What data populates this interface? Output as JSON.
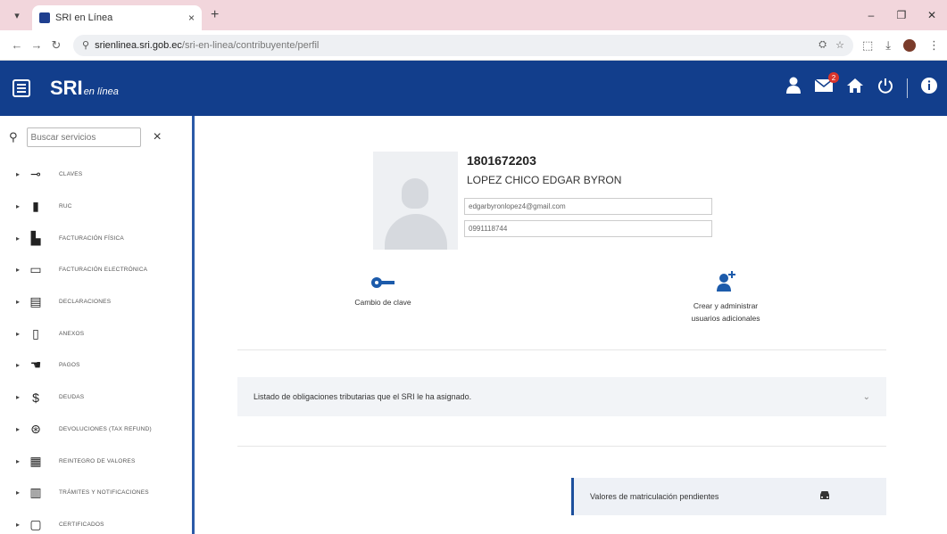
{
  "browser": {
    "tab_title": "SRI en Línea",
    "tab_close": "×",
    "new_tab": "+",
    "url_host": "srienlinea.sri.gob.ec",
    "url_path": "/sri-en-linea/contribuyente/perfil",
    "win_min": "–",
    "win_max": "❐",
    "win_close": "✕"
  },
  "header": {
    "logo": "SRI",
    "logo_suffix": "en línea",
    "notification_count": "2"
  },
  "sidebar": {
    "search_placeholder": "Buscar servicios",
    "close": "×",
    "items": [
      {
        "label": "CLAVES",
        "icon": "key-icon"
      },
      {
        "label": "RUC",
        "icon": "building-icon"
      },
      {
        "label": "FACTURACIÓN FÍSICA",
        "icon": "printer-icon"
      },
      {
        "label": "FACTURACIÓN ELECTRÓNICA",
        "icon": "laptop-icon"
      },
      {
        "label": "DECLARACIONES",
        "icon": "document-icon"
      },
      {
        "label": "ANEXOS",
        "icon": "file-icon"
      },
      {
        "label": "PAGOS",
        "icon": "hand-money-icon"
      },
      {
        "label": "DEUDAS",
        "icon": "dollar-icon"
      },
      {
        "label": "DEVOLUCIONES (TAX REFUND)",
        "icon": "refund-icon"
      },
      {
        "label": "REINTEGRO DE VALORES",
        "icon": "money-stack-icon"
      },
      {
        "label": "TRÁMITES Y NOTIFICACIONES",
        "icon": "notebook-icon"
      },
      {
        "label": "CERTIFICADOS",
        "icon": "certificate-icon"
      }
    ]
  },
  "profile": {
    "ruc": "1801672203",
    "name": "LOPEZ CHICO EDGAR BYRON",
    "email": "edgarbyronlopez4@gmail.com",
    "phone": "0991118744"
  },
  "actions": {
    "change_password": "Cambio de clave",
    "manage_users_line1": "Crear y administrar",
    "manage_users_line2": "usuarios adicionales"
  },
  "accordion": {
    "label": "Listado de obligaciones tributarias que el SRI le ha asignado."
  },
  "pending": {
    "label": "Valores de matriculación pendientes"
  }
}
